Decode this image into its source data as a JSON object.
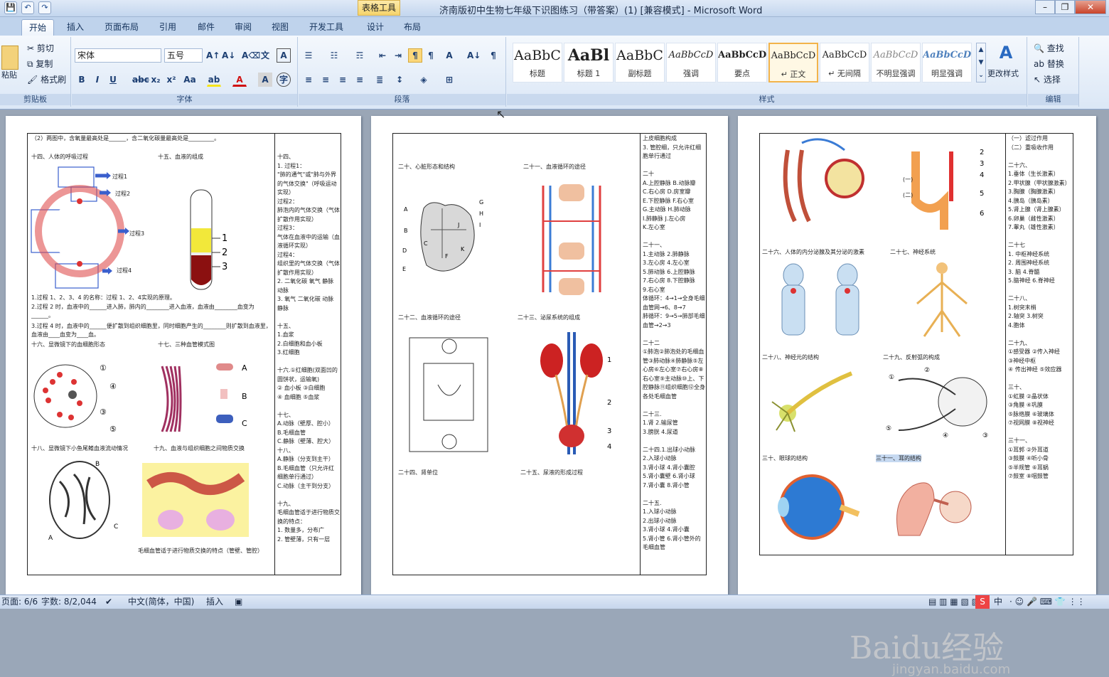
{
  "window": {
    "title": "济南版初中生物七年级下识图练习（带答案）(1) [兼容模式] - Microsoft Word",
    "context_tab": "表格工具"
  },
  "qat": {
    "save": "💾",
    "undo": "↶",
    "redo": "↷"
  },
  "tabs": [
    "开始",
    "插入",
    "页面布局",
    "引用",
    "邮件",
    "审阅",
    "视图",
    "开发工具",
    "设计",
    "布局"
  ],
  "clipboard": {
    "paste": "粘贴",
    "cut": "剪切",
    "copy": "复制",
    "format_painter": "格式刷",
    "label": "剪贴板"
  },
  "font": {
    "name": "宋体",
    "size": "五号",
    "label": "字体"
  },
  "paragraph": {
    "label": "段落"
  },
  "styles": {
    "label": "样式",
    "change": "更改样式",
    "items": [
      {
        "sample": "AaBbC",
        "name": "标题"
      },
      {
        "sample": "AaBl",
        "name": "标题 1"
      },
      {
        "sample": "AaBbC",
        "name": "副标题"
      },
      {
        "sample": "AaBbCcD",
        "name": "强调"
      },
      {
        "sample": "AaBbCcD",
        "name": "要点"
      },
      {
        "sample": "AaBbCcD",
        "name": "↵ 正文"
      },
      {
        "sample": "AaBbCcD",
        "name": "↵ 无间隔"
      },
      {
        "sample": "AaBbCcD",
        "name": "不明显强调"
      },
      {
        "sample": "AaBbCcD",
        "name": "明显强调"
      }
    ]
  },
  "editing": {
    "find": "查找",
    "replace": "替换",
    "select": "选择",
    "label": "编辑"
  },
  "page1": {
    "top": "（2）两图中，含氧量最高处是______，含二氧化碳量最高处是_________。",
    "s14": "十四、人体的呼吸过程",
    "s15": "十五、血液的组成",
    "labels14": [
      "过程1",
      "过程2",
      "过程3",
      "过程4"
    ],
    "q1": "1.过程 1、2、3、4 的名称：过程 1、2、4实现的原理。",
    "q2": "2.过程 2 时，血液中的______进入肺，肺内的________进入血液，血液由________血变为______。",
    "q3": "3.过程 4 时，血液中的______便扩散到组织细胞里，同时细胞产生的________则扩散到血液里，血液由____血变为____血。",
    "s16": "十六、显微镜下的血细胞形态",
    "s17": "十七、三种血管模式图",
    "s18": "十八、显微镜下小鱼尾鳍血液流动情况",
    "s19": "十九、血液与组织细胞之间物质交换",
    "cap19": "毛细血管适于进行物质交换的特点（管壁、管腔）",
    "answers": "十四、\n1. 过程1：\n\"肺的通气\"或\"肺与外界的气体交换\"（呼吸运动实现）\n过程2：\n肺泡内的气体交换（气体扩散作用实现）\n过程3：\n气体在血液中的运输（血液循环实现）\n过程4：\n组织里的气体交换（气体扩散作用实现）\n2. 二氧化碳 氧气 静脉 动脉\n3. 氧气 二氧化碳 动脉 静脉\n\n十五、\n1.血浆\n2.白细胞和血小板\n3.红细胞\n\n十六.①红细胞(双面凹的圆饼状，运输氧)\n② 血小板 ③白细胞\n④ 血细胞 ⑤血浆\n\n十七、\nA.动脉（壁厚、腔小）\nB.毛细血管\nC.静脉（壁薄、腔大）\n十八、\nA.静脉（分支到主干）\nB.毛细血管（只允许红细胞单行通过）\nC.动脉（主干到分支）\n\n十九、\n毛细血管适于进行物质交换的特点：\n1. 数量多，分布广\n2. 管壁薄，只有一层"
  },
  "page2": {
    "s20": "二十、心脏形态和结构",
    "s21": "二十一、血液循环的途径",
    "s22": "二十二、血液循环的途径",
    "s23": "二十三、泌尿系统的组成",
    "s24": "二十四、肾单位",
    "s25": "二十五、尿液的形成过程",
    "heart_labels": [
      "A",
      "B",
      "C",
      "D",
      "E",
      "F",
      "G",
      "H",
      "I",
      "J",
      "K"
    ],
    "answers": "上皮细胞构成\n3. 管腔细，只允许红细胞单行通过\n\n二十\nA.上腔静脉 B.动脉瓣\nC.右心房 D.房室瓣\nE.下腔静脉 F.右心室\nG.主动脉 H.肺动脉\nI.肺静脉 J.左心房\nK.左心室\n\n二十一、\n1.主动脉 2.肺静脉\n3.左心房 4.左心室\n5.肺动脉 6.上腔静脉\n7.右心房 8.下腔静脉\n9.右心室\n体循环：4→1→全身毛细血管网→6、8→7\n肺循环：9→5→肺部毛细血管→2→3\n\n二十二\n①肺泡②肺泡处的毛细血管③肺动脉④肺静脉⑤左心房⑥左心室⑦右心房⑧右心室⑨主动脉⑩上、下腔静脉⑪组织细胞⑫全身各处毛细血管\n\n二十三.\n1.肾 2.输尿管\n3.膀胱 4.尿道\n\n二十四.1.出球小动脉\n2.入球小动脉\n3.肾小球 4.肾小囊腔\n5.肾小囊壁 6.肾小球\n7.肾小囊 8.肾小管\n\n二十五.\n1.入球小动脉\n2.出球小动脉\n3.肾小球 4.肾小囊\n5.肾小管 6.肾小管外的毛细血管"
  },
  "page3": {
    "s26": "二十六、人体的内分泌腺及其分泌的激素",
    "s27": "二十七、神经系统",
    "s28": "二十八、神经元的结构",
    "s29": "二十九、反射弧的构成",
    "s30": "三十、眼球的结构",
    "s31": "三十一、耳的结构",
    "labels_loop": [
      "(一)",
      "(二)"
    ],
    "answers": "（一）滤过作用\n（二）重吸收作用\n\n二十六、\n1.垂体（生长激素）\n2.甲状腺（甲状腺激素）\n3.胸腺（胸腺激素）\n4.胰岛（胰岛素）\n5.肾上腺（肾上腺素）\n6.卵巢（雌性激素）\n7.睾丸（雄性激素）\n\n二十七\n1. 中枢神经系统\n2. 周围神经系统\n3. 脑 4.脊髓\n5.脑神经 6.脊神经\n\n二十八、\n1.树突末梢\n2.轴突 3.树突\n4.胞体\n\n二十九、\n①感受器 ②传入神经\n③神经中枢\n④ 传出神经 ⑤效应器\n\n三十、\n①虹膜 ②晶状体\n③角膜 ④巩膜\n⑤脉络膜 ⑥玻璃体\n⑦视网膜 ⑧视神经\n\n三十一、\n①耳郭 ②外耳道\n③鼓膜 ④听小骨\n⑤半规管 ⑥耳蜗\n⑦鼓室 ⑧咽鼓管"
  },
  "status": {
    "page": "页面: 6/6",
    "words": "字数: 8/2,044",
    "lang": "中文(简体，中国)",
    "mode": "插入",
    "ime": "中"
  },
  "watermark": {
    "text": "Baidu经验",
    "url": "jingyan.baidu.com"
  }
}
